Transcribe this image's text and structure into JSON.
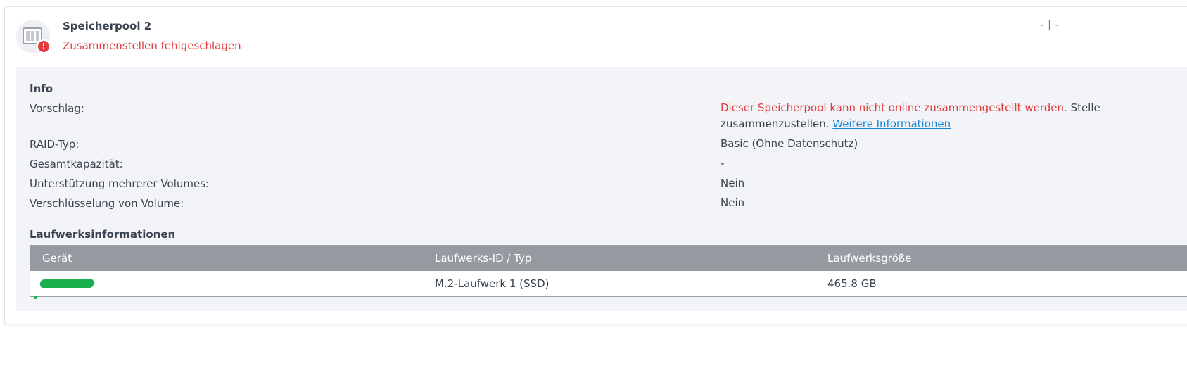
{
  "pool": {
    "name": "Speicherpool 2",
    "status": "Zusammenstellen fehlgeschlagen",
    "icon": "storage-pool-icon",
    "badge_icon": "error-icon",
    "badge_text": "!",
    "top_right": {
      "left": "-",
      "separator": "|",
      "right": "-"
    }
  },
  "info": {
    "title": "Info",
    "rows": [
      {
        "label": "Vorschlag:",
        "value_red": "Dieser Speicherpool kann nicht online zusammengestellt werden.",
        "value_rest": "Stelle",
        "value_line2": "zusammenzustellen.",
        "link": "Weitere Informationen"
      },
      {
        "label": "RAID-Typ:",
        "value": "Basic (Ohne Datenschutz)"
      },
      {
        "label": "Gesamtkapazität:",
        "value": "-"
      },
      {
        "label": "Unterstützung mehrerer Volumes:",
        "value": "Nein"
      },
      {
        "label": "Verschlüsselung von Volume:",
        "value": "Nein"
      }
    ]
  },
  "drives": {
    "title": "Laufwerksinformationen",
    "columns": [
      "Gerät",
      "Laufwerks-ID / Typ",
      "Laufwerksgröße"
    ],
    "rows": [
      {
        "device": "",
        "id_type": "M.2-Laufwerk 1 (SSD)",
        "size": "465.8 GB"
      }
    ]
  },
  "colors": {
    "error": "#e23b3b",
    "link": "#1a86d6",
    "accent": "#1a9bd7",
    "table_header": "#969ba2",
    "panel_bg": "#f3f4f7",
    "redaction": "#18b04b"
  }
}
